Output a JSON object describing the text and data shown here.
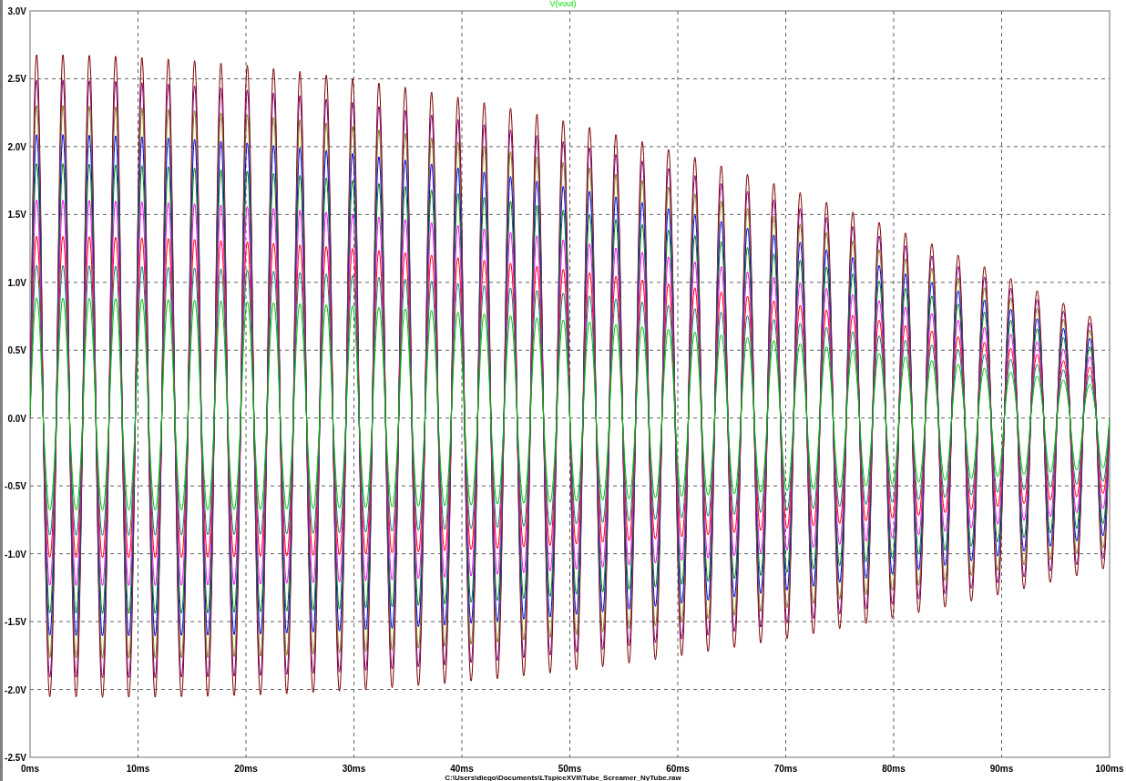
{
  "trace_label": "V(vout)",
  "y_ticks": [
    "3.0V",
    "2.5V",
    "2.0V",
    "1.5V",
    "1.0V",
    "0.5V",
    "0.0V",
    "-0.5V",
    "-1.0V",
    "-1.5V",
    "-2.0V",
    "-2.5V"
  ],
  "x_ticks": [
    "0ms",
    "10ms",
    "20ms",
    "30ms",
    "40ms",
    "50ms",
    "60ms",
    "70ms",
    "80ms",
    "90ms",
    "100ms"
  ],
  "file_path": "C:\\Users\\diego\\Documents\\LTspiceXVII\\Tube_Screamer_NyTube.raw"
}
